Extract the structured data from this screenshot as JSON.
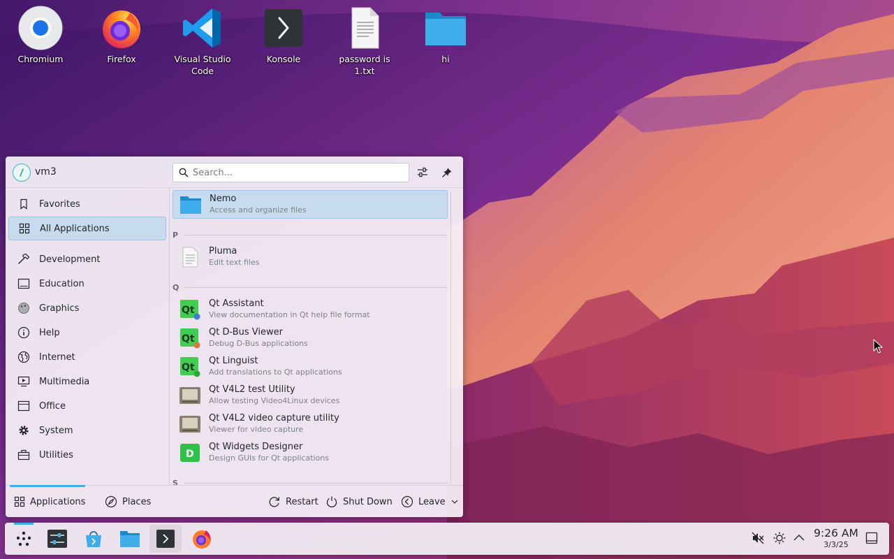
{
  "desktop": {
    "icons": [
      {
        "label": "Chromium",
        "icon": "chromium-icon"
      },
      {
        "label": "Firefox",
        "icon": "firefox-icon"
      },
      {
        "label": "Visual Studio Code",
        "icon": "vscode-icon"
      },
      {
        "label": "Konsole",
        "icon": "konsole-icon"
      },
      {
        "label": "password is 1.txt",
        "icon": "text-file-icon"
      },
      {
        "label": "hi",
        "icon": "folder-icon"
      }
    ]
  },
  "launcher": {
    "user_name": "vm3",
    "search": {
      "placeholder": "Search...",
      "value": ""
    },
    "categories": [
      {
        "label": "Favorites",
        "icon": "bookmark-icon"
      },
      {
        "label": "All Applications",
        "icon": "grid-icon",
        "active": true
      },
      {
        "label": "Development",
        "icon": "hammer-icon"
      },
      {
        "label": "Education",
        "icon": "education-icon"
      },
      {
        "label": "Graphics",
        "icon": "graphics-icon"
      },
      {
        "label": "Help",
        "icon": "help-icon"
      },
      {
        "label": "Internet",
        "icon": "globe-icon"
      },
      {
        "label": "Multimedia",
        "icon": "multimedia-icon"
      },
      {
        "label": "Office",
        "icon": "office-icon"
      },
      {
        "label": "System",
        "icon": "gear-icon"
      },
      {
        "label": "Utilities",
        "icon": "toolbox-icon"
      }
    ],
    "apps": [
      {
        "name": "Nemo",
        "desc": "Access and organize files",
        "icon": "folder-icon",
        "selected": true
      },
      {
        "section": "P"
      },
      {
        "name": "Pluma",
        "desc": "Edit text files",
        "icon": "text-file-icon"
      },
      {
        "section": "Q"
      },
      {
        "name": "Qt Assistant",
        "desc": "View documentation in Qt help file format",
        "icon": "qt-assistant-icon"
      },
      {
        "name": "Qt D-Bus Viewer",
        "desc": "Debug D-Bus applications",
        "icon": "qt-dbus-icon"
      },
      {
        "name": "Qt Linguist",
        "desc": "Add translations to Qt applications",
        "icon": "qt-linguist-icon"
      },
      {
        "name": "Qt V4L2 test Utility",
        "desc": "Allow testing Video4Linux devices",
        "icon": "v4l2-icon"
      },
      {
        "name": "Qt V4L2 video capture utility",
        "desc": "Viewer for video capture",
        "icon": "v4l2-icon"
      },
      {
        "name": "Qt Widgets Designer",
        "desc": "Design GUIs for Qt applications",
        "icon": "qt-designer-icon"
      },
      {
        "section": "S"
      }
    ],
    "footer": {
      "applications": "Applications",
      "places": "Places",
      "restart": "Restart",
      "shutdown": "Shut Down",
      "leave": "Leave"
    }
  },
  "taskbar": {
    "clock_time": "9:26 AM",
    "clock_date": "3/3/25"
  },
  "colors": {
    "accent": "#3daee9",
    "selection": "#c6dcee"
  }
}
